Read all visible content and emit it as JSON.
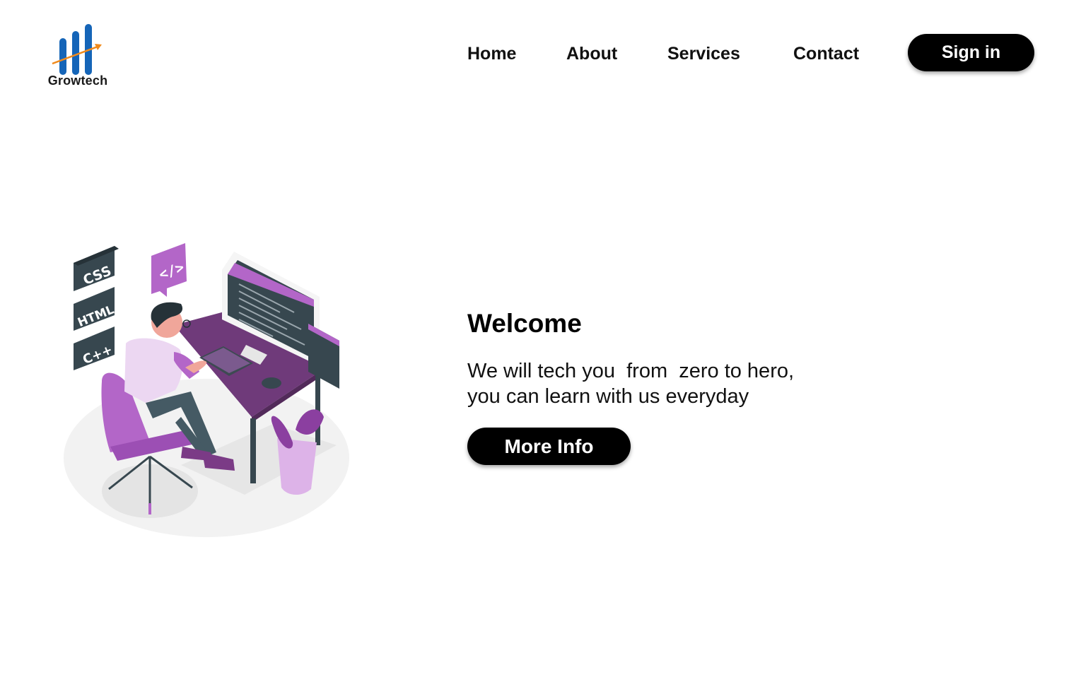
{
  "brand": {
    "name": "Growtech",
    "bar_color": "#1565b8",
    "arrow_color": "#f08a1c"
  },
  "nav": {
    "items": [
      {
        "label": "Home"
      },
      {
        "label": "About"
      },
      {
        "label": "Services"
      },
      {
        "label": "Contact"
      }
    ],
    "signin_label": "Sign in"
  },
  "hero": {
    "title": "Welcome",
    "lines": [
      "We will tech you  from  zero to hero,",
      "you can learn with us everyday"
    ],
    "cta_label": "More Info",
    "illustration": {
      "tags": [
        "CSS",
        "HTML",
        "C++",
        "</>"
      ],
      "accent_color": "#b366c8",
      "dark_color": "#37474f"
    }
  }
}
